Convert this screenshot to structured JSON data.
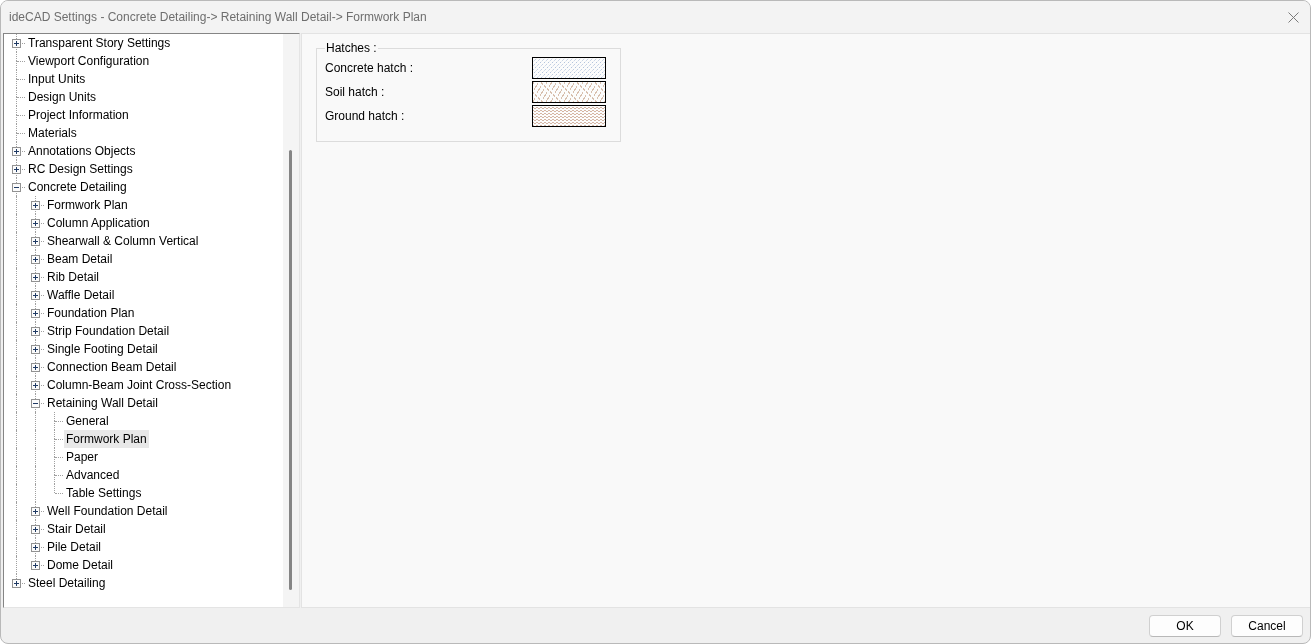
{
  "window": {
    "title": "ideCAD Settings - Concrete Detailing-> Retaining Wall Detail-> Formwork Plan"
  },
  "tree": {
    "items": [
      {
        "label": "Transparent Story Settings",
        "expanded": false,
        "selected": false
      },
      {
        "label": "Viewport Configuration",
        "selected": false
      },
      {
        "label": "Input Units",
        "selected": false
      },
      {
        "label": "Design Units",
        "selected": false
      },
      {
        "label": "Project Information",
        "selected": false
      },
      {
        "label": "Materials",
        "selected": false
      },
      {
        "label": "Annotations Objects",
        "expanded": false,
        "selected": false
      },
      {
        "label": "RC Design Settings",
        "expanded": false,
        "selected": false
      },
      {
        "label": "Concrete Detailing",
        "expanded": true,
        "selected": false,
        "children": [
          {
            "label": "Formwork Plan",
            "expanded": false,
            "selected": false
          },
          {
            "label": "Column Application",
            "expanded": false,
            "selected": false
          },
          {
            "label": "Shearwall & Column Vertical",
            "expanded": false,
            "selected": false
          },
          {
            "label": "Beam Detail",
            "expanded": false,
            "selected": false
          },
          {
            "label": "Rib Detail",
            "expanded": false,
            "selected": false
          },
          {
            "label": "Waffle Detail",
            "expanded": false,
            "selected": false
          },
          {
            "label": "Foundation Plan",
            "expanded": false,
            "selected": false
          },
          {
            "label": "Strip Foundation Detail",
            "expanded": false,
            "selected": false
          },
          {
            "label": "Single Footing Detail",
            "expanded": false,
            "selected": false
          },
          {
            "label": "Connection Beam Detail",
            "expanded": false,
            "selected": false
          },
          {
            "label": "Column-Beam Joint Cross-Section",
            "expanded": false,
            "selected": false
          },
          {
            "label": "Retaining Wall Detail",
            "expanded": true,
            "selected": false,
            "children": [
              {
                "label": "General",
                "selected": false
              },
              {
                "label": "Formwork Plan",
                "selected": true
              },
              {
                "label": "Paper",
                "selected": false
              },
              {
                "label": "Advanced",
                "selected": false
              },
              {
                "label": "Table Settings",
                "selected": false
              }
            ]
          },
          {
            "label": "Well Foundation Detail",
            "expanded": false,
            "selected": false
          },
          {
            "label": "Stair Detail",
            "expanded": false,
            "selected": false
          },
          {
            "label": "Pile Detail",
            "expanded": false,
            "selected": false
          },
          {
            "label": "Dome Detail",
            "expanded": false,
            "selected": false
          }
        ]
      },
      {
        "label": "Steel Detailing",
        "expanded": false,
        "selected": false
      }
    ]
  },
  "hatches": {
    "title": "Hatches :",
    "items": [
      {
        "label": "Concrete hatch :",
        "kind": "concrete",
        "color": "#b4c4dc"
      },
      {
        "label": "Soil hatch :",
        "kind": "soil",
        "color": "#d8bfae"
      },
      {
        "label": "Ground hatch :",
        "kind": "ground",
        "color": "#d4b5a4"
      }
    ]
  },
  "buttons": [
    "OK",
    "Cancel"
  ]
}
